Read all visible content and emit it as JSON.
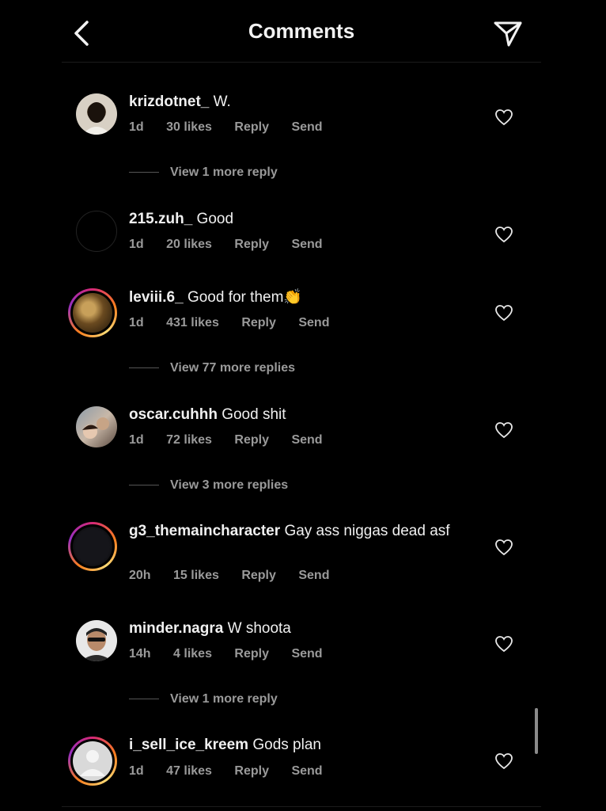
{
  "header": {
    "title": "Comments"
  },
  "comments": [
    {
      "username": "krizdotnet_",
      "text": "W.",
      "age": "1d",
      "likes": "30 likes",
      "reply": "Reply",
      "send": "Send",
      "more": "View 1 more reply"
    },
    {
      "username": "215.zuh_",
      "text": "Good",
      "age": "1d",
      "likes": "20 likes",
      "reply": "Reply",
      "send": "Send"
    },
    {
      "username": "leviii.6_",
      "text": "Good for them👏",
      "age": "1d",
      "likes": "431 likes",
      "reply": "Reply",
      "send": "Send",
      "more": "View 77 more replies"
    },
    {
      "username": "oscar.cuhhh",
      "text": "Good shit",
      "age": "1d",
      "likes": "72 likes",
      "reply": "Reply",
      "send": "Send",
      "more": "View 3 more replies"
    },
    {
      "username": "g3_themaincharacter",
      "text": "Gay ass niggas dead asf",
      "age": "20h",
      "likes": "15 likes",
      "reply": "Reply",
      "send": "Send"
    },
    {
      "username": "minder.nagra",
      "text": "W shoota",
      "age": "14h",
      "likes": "4 likes",
      "reply": "Reply",
      "send": "Send",
      "more": "View 1 more reply"
    },
    {
      "username": "i_sell_ice_kreem",
      "text": "Gods plan",
      "age": "1d",
      "likes": "47 likes",
      "reply": "Reply",
      "send": "Send"
    }
  ],
  "icons": {
    "back": "chevron-left-icon",
    "share": "paper-plane-icon",
    "like": "heart-outline-icon"
  },
  "colors": {
    "background": "#000000",
    "text": "#f5f5f5",
    "muted": "#9a9a9a"
  }
}
